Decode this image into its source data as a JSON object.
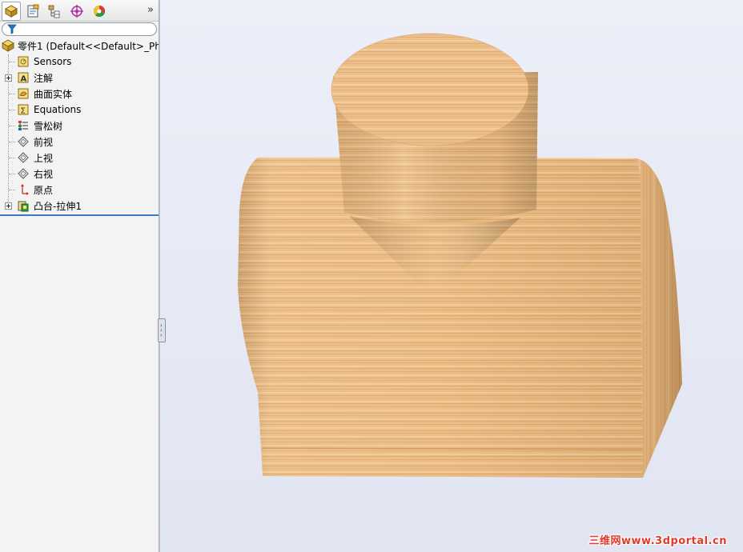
{
  "tabs": [
    {
      "icon": "feature-manager-icon",
      "active": true
    },
    {
      "icon": "property-manager-icon",
      "active": false
    },
    {
      "icon": "configuration-manager-icon",
      "active": false
    },
    {
      "icon": "dimxpert-manager-icon",
      "active": false
    },
    {
      "icon": "display-manager-icon",
      "active": false
    }
  ],
  "more_label": "»",
  "tree": {
    "root": {
      "label": "零件1  (Default<<Default>_Phc",
      "icon": "part-icon"
    },
    "items": [
      {
        "label": "Sensors",
        "icon": "sensors-icon",
        "expandable": false
      },
      {
        "label": "注解",
        "icon": "annotations-icon",
        "expandable": true
      },
      {
        "label": "曲面实体",
        "icon": "surface-bodies-icon",
        "expandable": false
      },
      {
        "label": "Equations",
        "icon": "equations-icon",
        "expandable": false
      },
      {
        "label": "雪松树",
        "icon": "material-icon",
        "expandable": false
      },
      {
        "label": "前视",
        "icon": "plane-icon",
        "expandable": false
      },
      {
        "label": "上视",
        "icon": "plane-icon",
        "expandable": false
      },
      {
        "label": "右视",
        "icon": "plane-icon",
        "expandable": false
      },
      {
        "label": "原点",
        "icon": "origin-icon",
        "expandable": false
      },
      {
        "label": "凸台-拉伸1",
        "icon": "extrude-icon",
        "expandable": true
      }
    ]
  },
  "watermark": "三维网www.3dportal.cn",
  "colors": {
    "wood_light": "#f0c58f",
    "wood_mid": "#e3ad70",
    "wood_dark": "#c98d4f",
    "viewport_bg": "#eceef8",
    "accent": "#3c79c4",
    "watermark": "#e23a2a"
  }
}
